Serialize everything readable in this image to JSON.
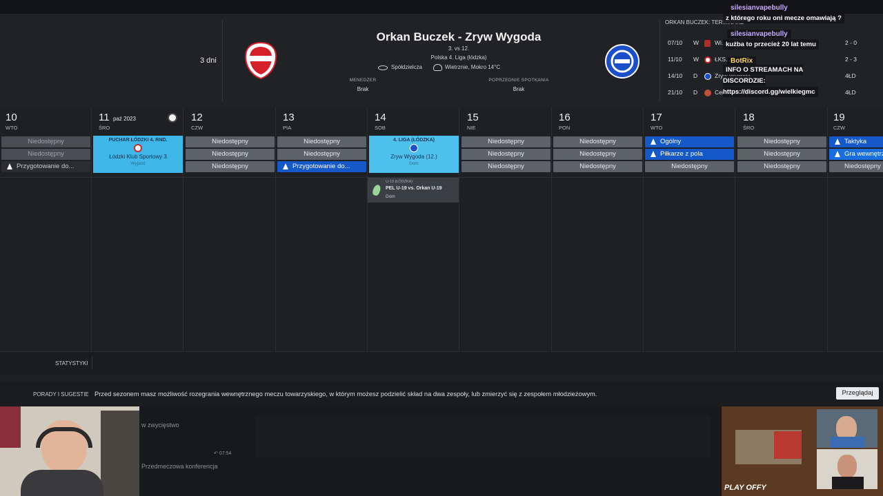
{
  "header": {
    "days_left": "3 dni",
    "match_title": "Orkan Buczek - Zryw Wygoda",
    "rank": "3. vs 12.",
    "league": "Polska 4. Liga (łódzka)",
    "stadium": "Spółdzielcza",
    "weather": "Wietrznie, Mokro 14°C",
    "manager_label": "MENEDŻER",
    "manager_value": "Brak",
    "previous_label": "POPRZEDNIE SPOTKANIA",
    "previous_value": "Brak",
    "home_crest_text": "ORKAN BUCZEK"
  },
  "fixtures": {
    "title": "ORKAN BUCZEK: TERMINARZ",
    "rows": [
      {
        "date": "07/10",
        "venue": "W",
        "team": "Wi...",
        "score": "2 - 0"
      },
      {
        "date": "11/10",
        "venue": "W",
        "team": "ŁKS...",
        "score": "2 - 3"
      },
      {
        "date": "14/10",
        "venue": "D",
        "team": "Zryw Wygoda",
        "score": "4ŁD"
      },
      {
        "date": "21/10",
        "venue": "D",
        "team": "Ceramika Opoczno",
        "score": "4ŁD"
      }
    ]
  },
  "chat": [
    {
      "name": "silesianvapebully",
      "msg": "z którego roku oni mecze omawiają ?"
    },
    {
      "name": "silesianvapebully",
      "msg": "kużba to przecież 20 lat temu"
    },
    {
      "name": "BotRix",
      "msg": "INFO O STREAMACH NA DISCORDZIE: https://discord.gg/wielkiegmc"
    }
  ],
  "calendar": {
    "month_label": "paź 2023",
    "days": [
      {
        "num": "10",
        "name": "WTO",
        "items": [
          "Niedostępny",
          "Niedostępny",
          "Przygotowanie do..."
        ]
      },
      {
        "num": "11",
        "name": "ŚRO",
        "cup": {
          "title": "PUCHAR ŁÓDZKI 4. RND.",
          "opponent": "Łódzki Klub Sportowy 3",
          "venue": "Wyjazd"
        }
      },
      {
        "num": "12",
        "name": "CZW",
        "items": [
          "Niedostępny",
          "Niedostępny",
          "Niedostępny"
        ]
      },
      {
        "num": "13",
        "name": "PIA",
        "items": [
          "Niedostępny",
          "Niedostępny",
          "Przygotowanie do..."
        ]
      },
      {
        "num": "14",
        "name": "SOB",
        "cup": {
          "title": "4. LIGA (ŁÓDZKA)",
          "opponent": "Zryw Wygoda (12.)",
          "venue": "Dom"
        },
        "youth": {
          "league": "U-19 (ŁÓDZKA)",
          "match": "PEL U-19 vs. Orkan U-19",
          "venue": "Dom"
        }
      },
      {
        "num": "15",
        "name": "NIE",
        "items": [
          "Niedostępny",
          "Niedostępny",
          "Niedostępny"
        ]
      },
      {
        "num": "16",
        "name": "PON",
        "items": [
          "Niedostępny",
          "Niedostępny",
          "Niedostępny"
        ]
      },
      {
        "num": "17",
        "name": "WTO",
        "items": [
          "Ogólny",
          "Piłkarze z pola",
          "Niedostępny"
        ]
      },
      {
        "num": "18",
        "name": "ŚRO",
        "items": [
          "Niedostępny",
          "Niedostępny",
          "Niedostępny"
        ]
      },
      {
        "num": "19",
        "name": "CZW",
        "items": [
          "Taktyka",
          "Gra wewnętrzna",
          "Niedostępny"
        ]
      }
    ]
  },
  "stats_label": "STATYSTYKI",
  "advice": {
    "label": "PORADY I SUGESTIE",
    "text": "Przed sezonem masz możliwość rozegrania wewnętrznego meczu towarzyskiego, w którym możesz podzielić skład na dwa zespoły, lub zmierzyć się z zespołem młodzieżowym.",
    "button": "Przeglądaj"
  },
  "bottom": {
    "line1": "w zwycięstwo",
    "time": "07:54",
    "line2": "Przedmeczowa konferencja"
  },
  "colors": {
    "accent_blue": "#1558c7",
    "cup_blue": "#3fb6e8",
    "gray_pill": "#5d6268"
  }
}
